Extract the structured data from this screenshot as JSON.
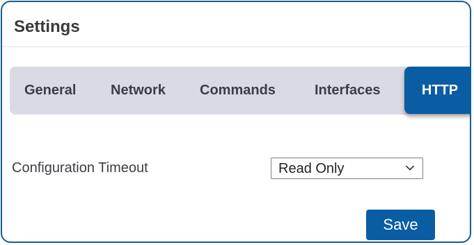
{
  "panel": {
    "title": "Settings"
  },
  "tabs": [
    {
      "label": "General",
      "active": false
    },
    {
      "label": "Network",
      "active": false
    },
    {
      "label": "Commands",
      "active": false
    },
    {
      "label": "Interfaces",
      "active": false
    },
    {
      "label": "HTTP",
      "active": true
    }
  ],
  "form": {
    "configuration_timeout": {
      "label": "Configuration Timeout",
      "selected": "Read Only",
      "icon": "chevron-down-icon"
    }
  },
  "actions": {
    "save_label": "Save"
  },
  "colors": {
    "accent": "#0a5da3",
    "border": "#0f5e93",
    "tabbar_bg": "#d9dae4",
    "text": "#3b3e45"
  }
}
